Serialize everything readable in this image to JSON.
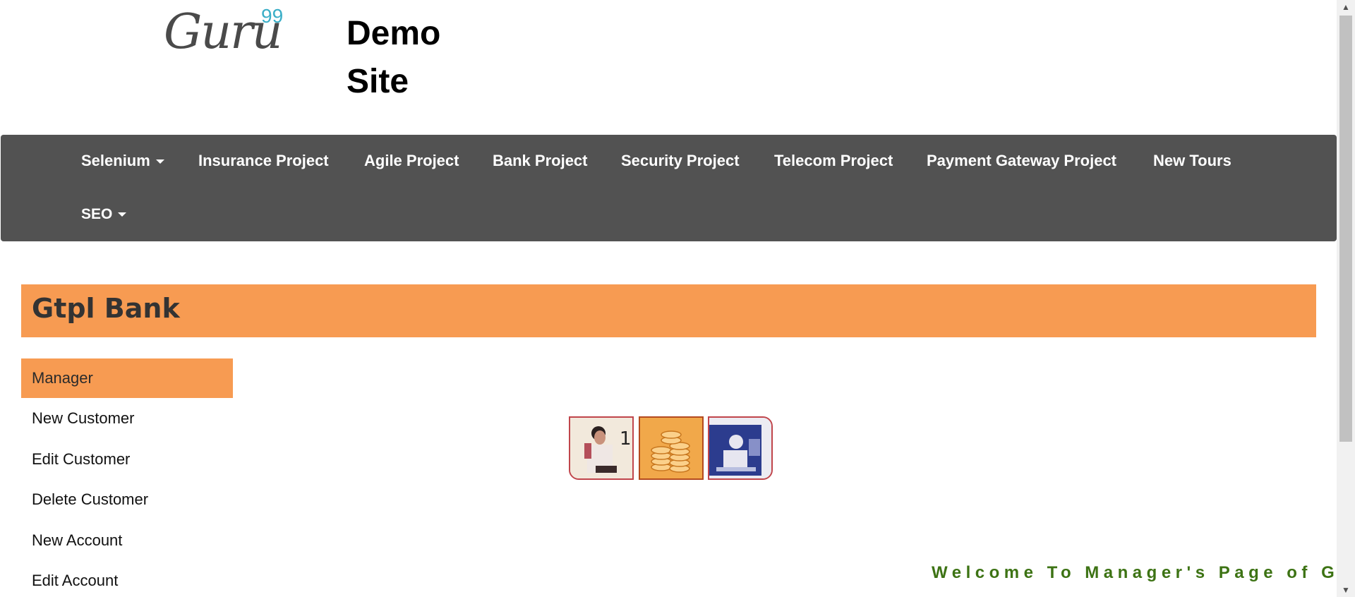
{
  "header": {
    "logo_text": "Guru",
    "logo_superscript": "99",
    "site_title_line1": "Demo",
    "site_title_line2": "Site"
  },
  "navbar": {
    "items": [
      {
        "label": "Selenium",
        "dropdown": true
      },
      {
        "label": "Insurance Project"
      },
      {
        "label": "Agile Project"
      },
      {
        "label": "Bank Project"
      },
      {
        "label": "Security Project"
      },
      {
        "label": "Telecom Project"
      },
      {
        "label": "Payment Gateway Project"
      },
      {
        "label": "New Tours"
      },
      {
        "label": "SEO",
        "dropdown": true
      }
    ]
  },
  "bank": {
    "title": "Gtpl Bank"
  },
  "menu": {
    "items": [
      {
        "label": "Manager",
        "active": true
      },
      {
        "label": "New Customer"
      },
      {
        "label": "Edit Customer"
      },
      {
        "label": "Delete Customer"
      },
      {
        "label": "New Account"
      },
      {
        "label": "Edit Account"
      }
    ]
  },
  "images": [
    "phone-man-image",
    "coins-image",
    "woman-computer-image"
  ],
  "welcome_text": "Welcome To Manager's Page of G",
  "colors": {
    "navbar": "#525252",
    "banner": "#f79b52",
    "welcome": "#3d7314",
    "logo_accent": "#3aaec7"
  }
}
